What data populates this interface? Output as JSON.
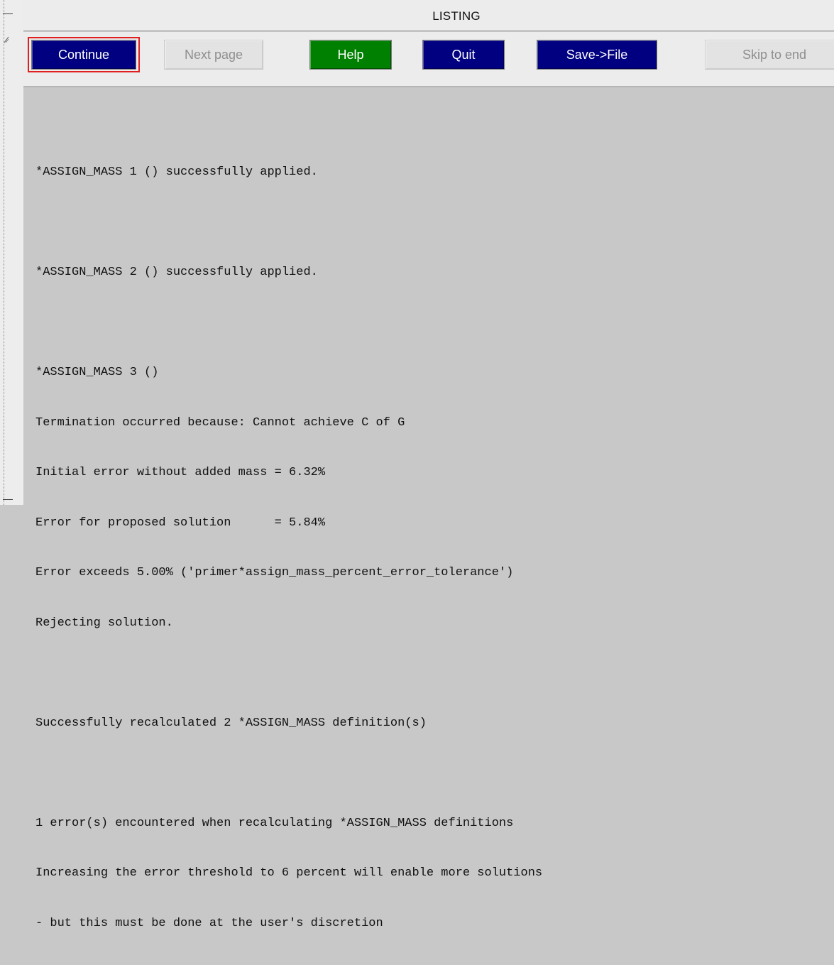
{
  "window": {
    "title": "LISTING"
  },
  "toolbar": {
    "continue_label": "Continue",
    "next_page_label": "Next page",
    "help_label": "Help",
    "quit_label": "Quit",
    "save_label": "Save->File",
    "skip_label": "Skip to end"
  },
  "colors": {
    "button_blue": "#010080",
    "button_green": "#008000",
    "focus_ring": "#e02020",
    "content_background": "#c8c8c8"
  },
  "listing": {
    "lines": [
      "*ASSIGN_MASS 1 () successfully applied.",
      "",
      "*ASSIGN_MASS 2 () successfully applied.",
      "",
      "*ASSIGN_MASS 3 ()",
      "Termination occurred because: Cannot achieve C of G",
      "Initial error without added mass = 6.32%",
      "Error for proposed solution      = 5.84%",
      "Error exceeds 5.00% ('primer*assign_mass_percent_error_tolerance')",
      "Rejecting solution.",
      "",
      "Successfully recalculated 2 *ASSIGN_MASS definition(s)",
      "",
      "1 error(s) encountered when recalculating *ASSIGN_MASS definitions",
      "Increasing the error threshold to 6 percent will enable more solutions",
      "- but this must be done at the user's discretion"
    ]
  }
}
